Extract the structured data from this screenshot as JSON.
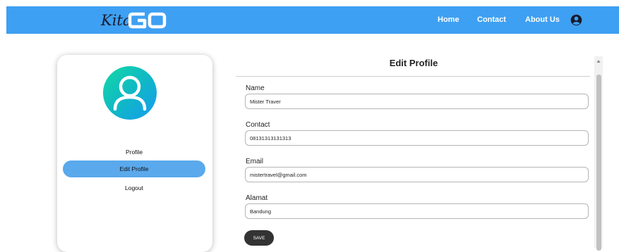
{
  "brand": {
    "script": "Kita",
    "go": "GO"
  },
  "nav": {
    "home": "Home",
    "contact": "Contact",
    "about": "About Us"
  },
  "sidebar": {
    "items": [
      {
        "label": "Profile",
        "active": false
      },
      {
        "label": "Edit Profile",
        "active": true
      },
      {
        "label": "Logout",
        "active": false
      }
    ]
  },
  "form": {
    "title": "Edit Profile",
    "fields": [
      {
        "label": "Name",
        "value": "Mister Traver"
      },
      {
        "label": "Contact",
        "value": "08131313131313"
      },
      {
        "label": "Email",
        "value": "mistertravel@gmail.com"
      },
      {
        "label": "Alamat",
        "value": "Bandung"
      }
    ],
    "save_label": "SAVE"
  },
  "colors": {
    "navbar": "#3ea0f2",
    "active_menu": "#5aa9ec",
    "avatar_start": "#12d9a4",
    "avatar_end": "#159bf0"
  },
  "icons": {
    "user": "account-circle-icon",
    "avatar": "person-outline-icon"
  }
}
